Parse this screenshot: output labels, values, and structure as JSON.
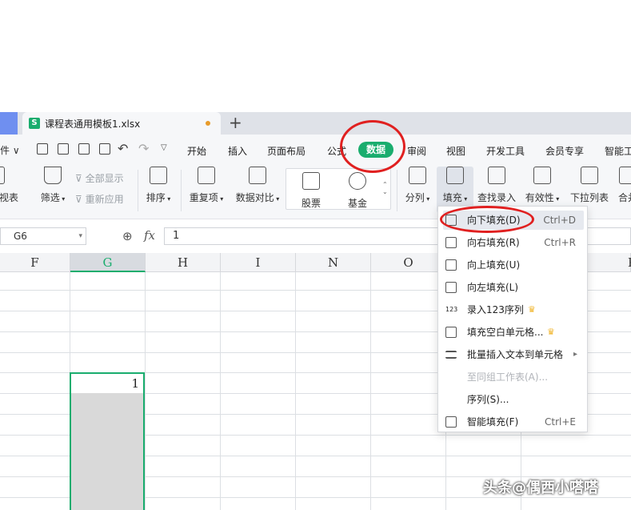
{
  "tab": {
    "title": "课程表通用模板1.xlsx",
    "new_tab": "+"
  },
  "menubar": {
    "file": "件 ∨",
    "items": [
      "开始",
      "插入",
      "页面布局",
      "公式",
      "数据",
      "审阅",
      "视图",
      "开发工具",
      "会员专享",
      "智能工"
    ]
  },
  "ribbon": {
    "pivot": "视表",
    "filter": "筛选",
    "show_all": "全部显示",
    "reapply": "重新应用",
    "sort": "排序",
    "duplicates": "重复项",
    "compare": "数据对比",
    "stock": "股票",
    "fund": "基金",
    "split": "分列",
    "fill": "填充",
    "lookup": "查找录入",
    "validity": "有效性",
    "dropdown_list": "下拉列表",
    "merge": "合并"
  },
  "formula_bar": {
    "name_box": "G6",
    "fx": "fx",
    "value": "1"
  },
  "columns": [
    "F",
    "G",
    "H",
    "I",
    "N",
    "O",
    "P"
  ],
  "cell_value": "1",
  "fill_menu": [
    {
      "label": "向下填充(D)",
      "shortcut": "Ctrl+D"
    },
    {
      "label": "向右填充(R)",
      "shortcut": "Ctrl+R"
    },
    {
      "label": "向上填充(U)",
      "shortcut": ""
    },
    {
      "label": "向左填充(L)",
      "shortcut": ""
    },
    {
      "label": "录入123序列",
      "shortcut": ""
    },
    {
      "label": "填充空白单元格...",
      "shortcut": ""
    },
    {
      "label": "批量插入文本到单元格",
      "shortcut": ""
    },
    {
      "label": "至同组工作表(A)...",
      "shortcut": ""
    },
    {
      "label": "序列(S)...",
      "shortcut": ""
    },
    {
      "label": "智能填充(F)",
      "shortcut": "Ctrl+E"
    }
  ],
  "watermark": "头条@偶西小嗒嗒",
  "colors": {
    "accent": "#1aad6e",
    "annotation": "#e02020"
  }
}
